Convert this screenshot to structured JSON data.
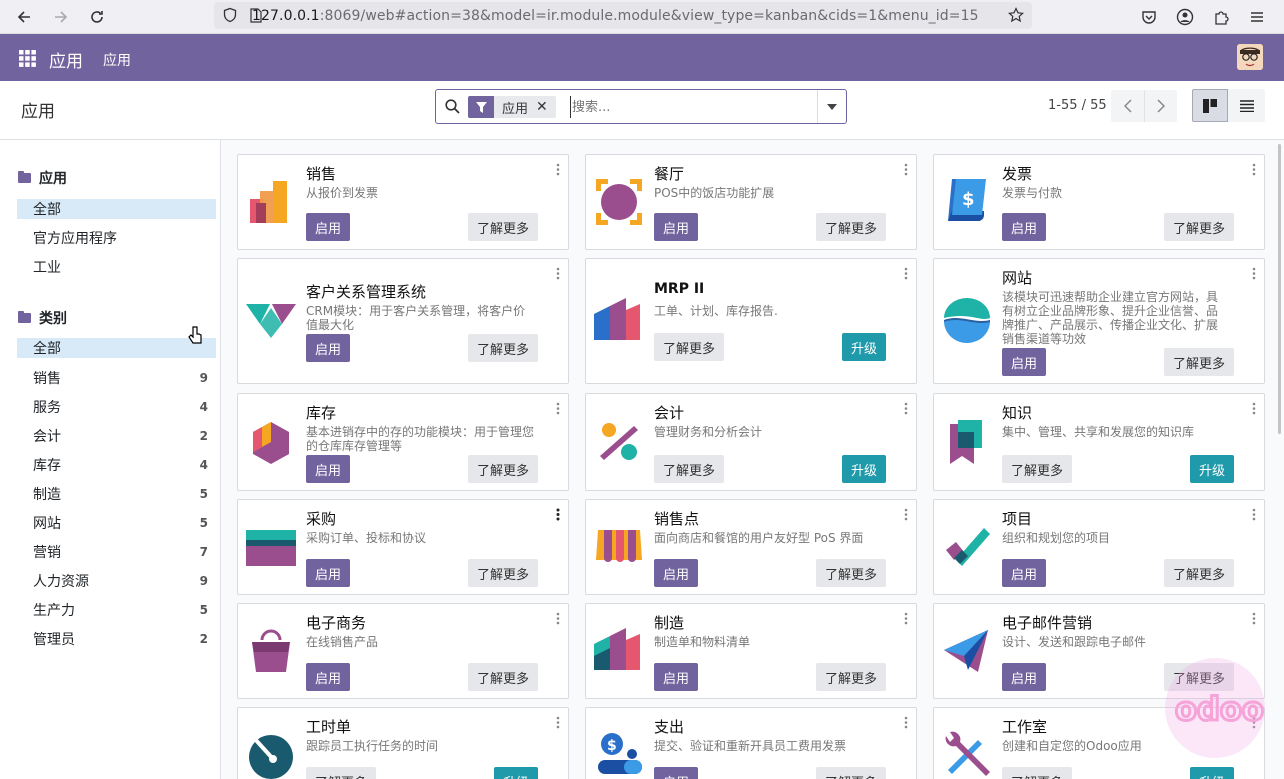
{
  "browser": {
    "url_host": "127.0.0.1",
    "url_rest": ":8069/web#action=38&model=ir.module.module&view_type=kanban&cids=1&menu_id=15"
  },
  "navbar": {
    "app_title": "应用",
    "menu_item": "应用"
  },
  "control_panel": {
    "breadcrumb": "应用",
    "facet_label": "应用",
    "search_placeholder": "搜索...",
    "pager": "1-55 / 55"
  },
  "sidebar": {
    "section1_title": "应用",
    "section1_items": [
      {
        "label": "全部",
        "active": true
      },
      {
        "label": "官方应用程序"
      },
      {
        "label": "工业"
      }
    ],
    "section2_title": "类别",
    "section2_items": [
      {
        "label": "全部",
        "count": "",
        "active": true
      },
      {
        "label": "销售",
        "count": "9"
      },
      {
        "label": "服务",
        "count": "4"
      },
      {
        "label": "会计",
        "count": "2"
      },
      {
        "label": "库存",
        "count": "4"
      },
      {
        "label": "制造",
        "count": "5"
      },
      {
        "label": "网站",
        "count": "5"
      },
      {
        "label": "营销",
        "count": "7"
      },
      {
        "label": "人力资源",
        "count": "9"
      },
      {
        "label": "生产力",
        "count": "5"
      },
      {
        "label": "管理员",
        "count": "2"
      }
    ]
  },
  "labels": {
    "activate": "启用",
    "learn_more": "了解更多",
    "upgrade": "升级"
  },
  "apps": [
    {
      "name": "销售",
      "summary": "从报价到发票",
      "icon": "sales-icon"
    },
    {
      "name": "餐厅",
      "summary": "POS中的饭店功能扩展",
      "icon": "restaurant-icon"
    },
    {
      "name": "发票",
      "summary": "发票与付款",
      "icon": "invoicing-icon"
    },
    {
      "name": "客户关系管理系统",
      "summary": "CRM模块：用于客户关系管理，将客户价值最大化",
      "icon": "crm-icon"
    },
    {
      "name": "MRP II",
      "summary": "工单、计划、库存报告.",
      "icon": "mrp-icon"
    },
    {
      "name": "网站",
      "summary": "该模块可迅速帮助企业建立官方网站，具有树立企业品牌形象、提升企业信誉、品牌推广、产品展示、传播企业文化、扩展销售渠道等功效",
      "icon": "website-icon"
    },
    {
      "name": "库存",
      "summary": "基本进销存中的存的功能模块：用于管理您的仓库库存管理等",
      "icon": "inventory-icon"
    },
    {
      "name": "会计",
      "summary": "管理财务和分析会计",
      "icon": "accounting-icon"
    },
    {
      "name": "知识",
      "summary": "集中、管理、共享和发展您的知识库",
      "icon": "knowledge-icon"
    },
    {
      "name": "采购",
      "summary": "采购订单、投标和协议",
      "icon": "purchase-icon"
    },
    {
      "name": "销售点",
      "summary": "面向商店和餐馆的用户友好型 PoS 界面",
      "icon": "pos-icon"
    },
    {
      "name": "项目",
      "summary": "组织和规划您的项目",
      "icon": "project-icon"
    },
    {
      "name": "电子商务",
      "summary": "在线销售产品",
      "icon": "ecommerce-icon"
    },
    {
      "name": "制造",
      "summary": "制造单和物料清单",
      "icon": "manufacturing-icon"
    },
    {
      "name": "电子邮件营销",
      "summary": "设计、发送和跟踪电子邮件",
      "icon": "email-marketing-icon"
    },
    {
      "name": "工时单",
      "summary": "跟踪员工执行任务的时间",
      "icon": "timesheet-icon"
    },
    {
      "name": "支出",
      "summary": "提交、验证和重新开具员工费用发票",
      "icon": "expenses-icon"
    },
    {
      "name": "工作室",
      "summary": "创建和自定您的Odoo应用",
      "icon": "studio-icon"
    }
  ],
  "watermark": "odoo"
}
